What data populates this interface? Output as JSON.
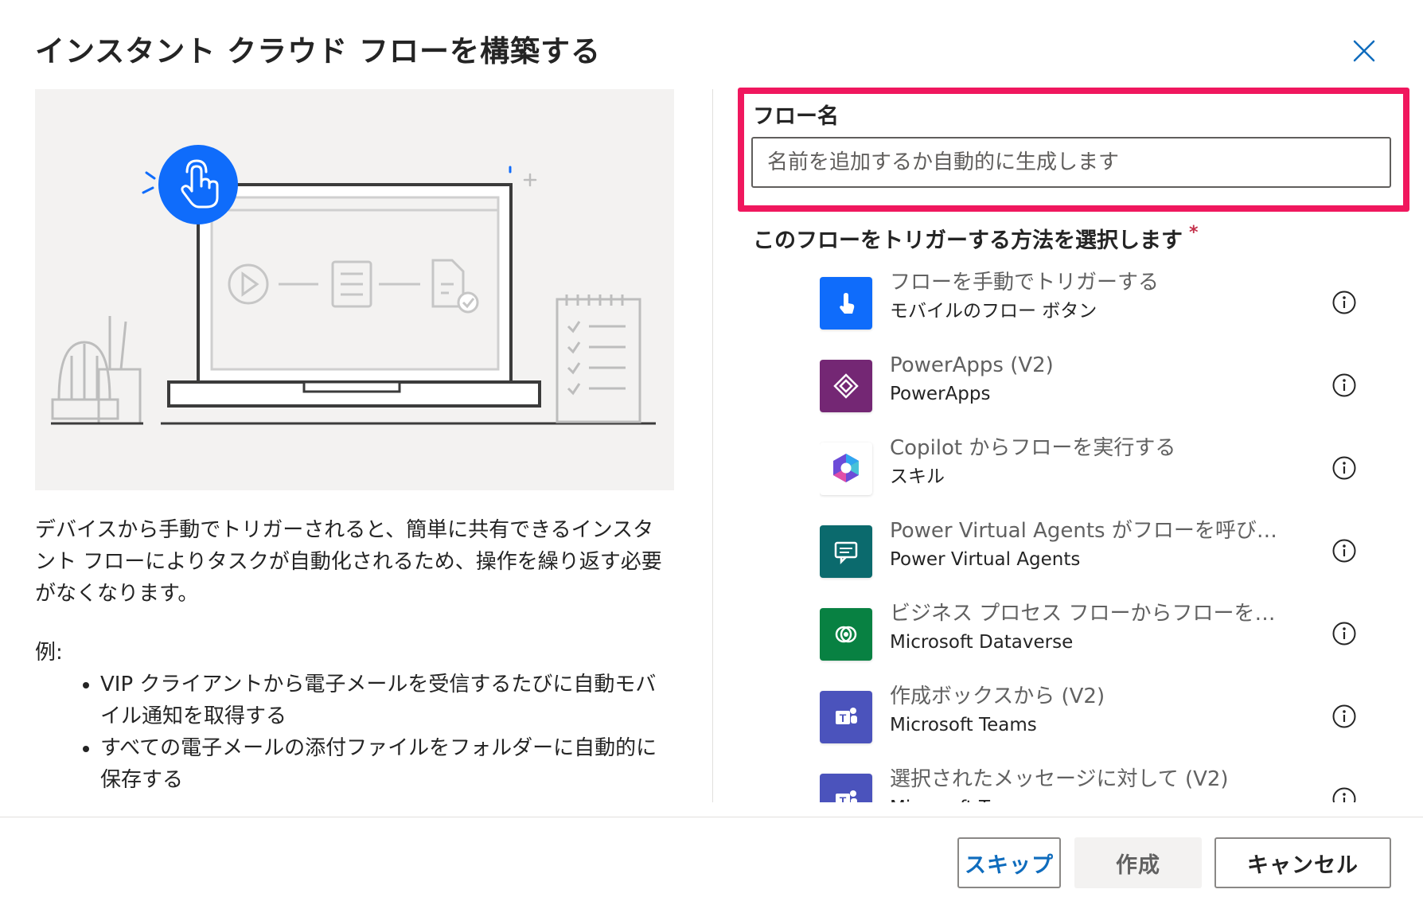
{
  "dialog": {
    "title": "インスタント クラウド フローを構築する"
  },
  "left": {
    "description": "デバイスから手動でトリガーされると、簡単に共有できるインスタント フローによりタスクが自動化されるため、操作を繰り返す必要がなくなります。",
    "examples_label": "例:",
    "examples": [
      "VIP クライアントから電子メールを受信するたびに自動モバイル通知を取得する",
      "すべての電子メールの添付ファイルをフォルダーに自動的に保存する"
    ]
  },
  "form": {
    "flow_name_label": "フロー名",
    "flow_name_value": "",
    "flow_name_placeholder": "名前を追加するか自動的に生成します",
    "trigger_label": "このフローをトリガーする方法を選択します",
    "required_mark": "*",
    "highlight_color": "#f0175e"
  },
  "triggers": [
    {
      "title": "フローを手動でトリガーする",
      "subtitle": "モバイルのフロー ボタン",
      "icon": "touch-hand-icon",
      "color": "#0f6cfb"
    },
    {
      "title": "PowerApps (V2)",
      "subtitle": "PowerApps",
      "icon": "powerapps-icon",
      "color": "#742774"
    },
    {
      "title": "Copilot からフローを実行する",
      "subtitle": "スキル",
      "icon": "copilot-icon",
      "color": "#ffffff"
    },
    {
      "title": "Power Virtual Agents がフローを呼び出したとき",
      "subtitle": "Power Virtual Agents",
      "icon": "virtual-agents-icon",
      "color": "#0b6a6d"
    },
    {
      "title": "ビジネス プロセス フローからフローを実行する",
      "subtitle": "Microsoft Dataverse",
      "icon": "dataverse-icon",
      "color": "#088142"
    },
    {
      "title": "作成ボックスから (V2)",
      "subtitle": "Microsoft Teams",
      "icon": "teams-icon",
      "color": "#4b53bc"
    },
    {
      "title": "選択されたメッセージに対して (V2)",
      "subtitle": "Microsoft Teams",
      "icon": "teams-icon",
      "color": "#4b53bc"
    }
  ],
  "footer": {
    "skip_label": "スキップ",
    "create_label": "作成",
    "cancel_label": "キャンセル"
  },
  "colors": {
    "accent": "#0f6cbd",
    "touch_badge": "#0f6cfb"
  }
}
